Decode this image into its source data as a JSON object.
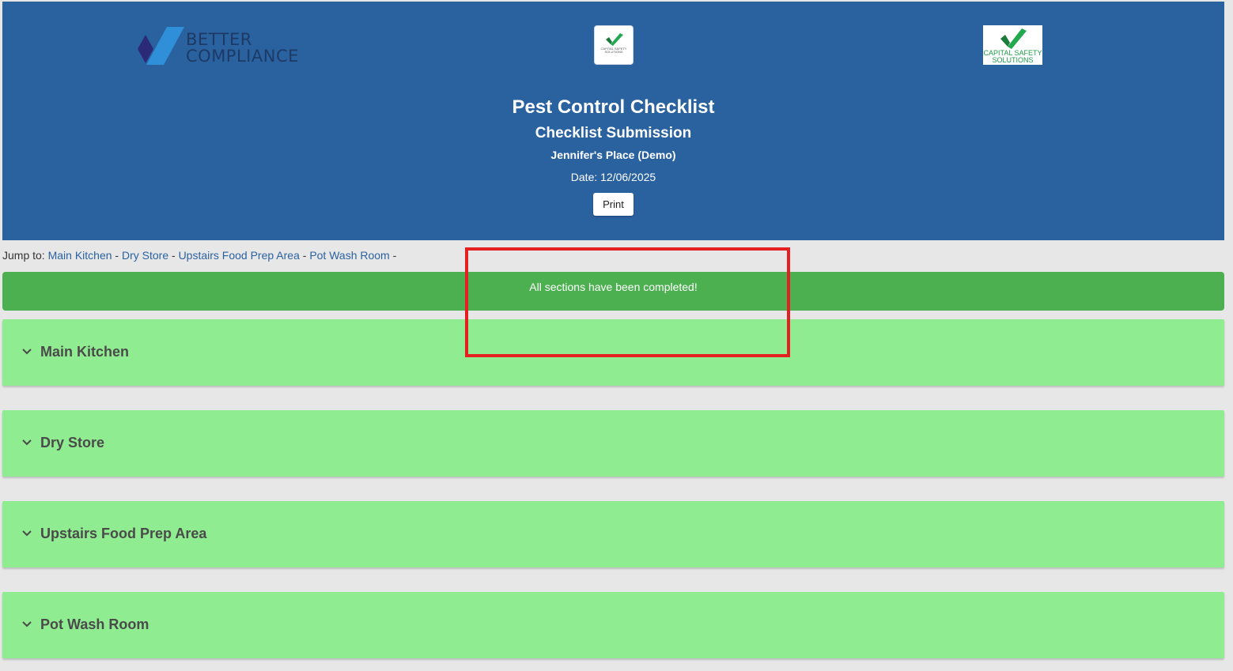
{
  "header": {
    "logo_left_line1": "BETTER",
    "logo_left_line2": "COMPLIANCE",
    "logo_center_text": "CAPITAL SAFETY SOLUTIONS",
    "logo_right_line1": "CAPITAL SAFETY",
    "logo_right_line2": "SOLUTIONS",
    "title": "Pest Control Checklist",
    "subtitle": "Checklist Submission",
    "place": "Jennifer's Place (Demo)",
    "date": "Date: 12/06/2025",
    "print_label": "Print"
  },
  "jump": {
    "prefix": "Jump to:",
    "links": [
      "Main Kitchen",
      "Dry Store",
      "Upstairs Food Prep Area",
      "Pot Wash Room"
    ],
    "separator": "-"
  },
  "banner": {
    "message": "All sections have been completed!"
  },
  "sections": [
    {
      "label": "Main Kitchen",
      "icon": "chevron-down-icon"
    },
    {
      "label": "Dry Store",
      "icon": "chevron-down-icon"
    },
    {
      "label": "Upstairs Food Prep Area",
      "icon": "chevron-down-icon"
    },
    {
      "label": "Pot Wash Room",
      "icon": "chevron-down-icon"
    }
  ],
  "colors": {
    "header_bg": "#2a62a0",
    "banner_bg": "#4caf50",
    "section_bg": "#90ec90",
    "highlight": "#e62020"
  }
}
